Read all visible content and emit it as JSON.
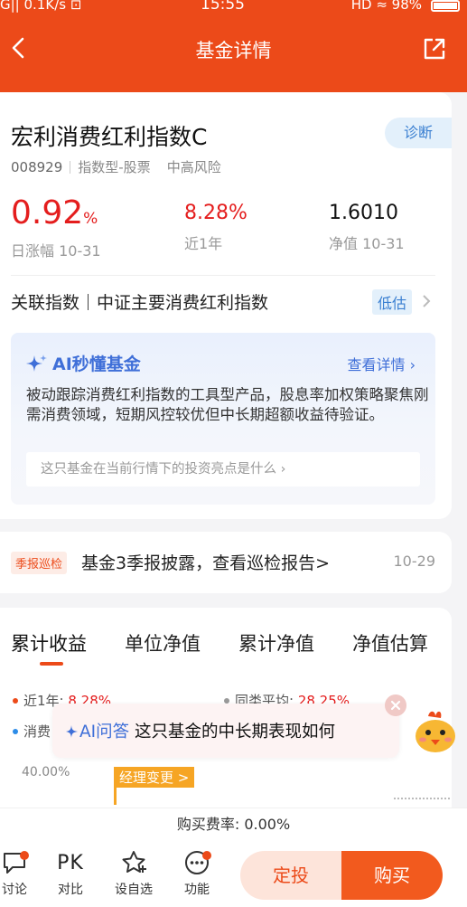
{
  "status": {
    "left": "G|| 0.1K/s ⊡",
    "time": "15:55",
    "right": "HD ≈ 98%"
  },
  "nav": {
    "title": "基金详情"
  },
  "fund": {
    "name": "宏利消费红利指数C",
    "diagnose_label": "诊断",
    "code": "008929",
    "type": "指数型-股票",
    "risk": "中高风险",
    "daily_change": "0.92",
    "daily_change_unit": "%",
    "daily_change_label": "日涨幅 10-31",
    "year_return": "8.28%",
    "year_return_label": "近1年",
    "nav_value": "1.6010",
    "nav_label": "净值 10-31"
  },
  "index_row": {
    "prefix": "关联指数",
    "index_name": "中证主要消费红利指数",
    "valuation_badge": "低估"
  },
  "ai_box": {
    "title": "AI秒懂基金",
    "more": "查看详情 ›",
    "text": "被动跟踪消费红利指数的工具型产品，股息率加权策略聚焦刚需消费领域，短期风控较优但中长期超额收益待验证。",
    "question": "这只基金在当前行情下的投资亮点是什么 ›"
  },
  "quarter": {
    "tag": "季报巡检",
    "text": "基金3季报披露，查看巡检报告>",
    "date": "10-29"
  },
  "tabs": [
    {
      "label": "累计收益"
    },
    {
      "label": "单位净值"
    },
    {
      "label": "累计净值"
    },
    {
      "label": "净值估算"
    }
  ],
  "legend": {
    "item1_label": "近1年: ",
    "item1_value": "8.28%",
    "item2_label": "同类平均: ",
    "item2_value": "28.25%",
    "item3_label": "消费"
  },
  "chart": {
    "y_label": "40.00%",
    "manager_tag": "经理变更 >"
  },
  "ai_popup": {
    "label": "AI问答",
    "question": "这只基金的中长期表现如何"
  },
  "fee": {
    "text": "购买费率: 0.00%"
  },
  "bottom_bar": {
    "discuss": "讨论",
    "compare_icon": "PK",
    "compare": "对比",
    "watchlist": "设自选",
    "functions": "功能",
    "dingtou": "定投",
    "buy": "购买"
  },
  "colors": {
    "brand": "#ec4a19",
    "up": "#e41d1d",
    "ai_blue": "#3f6fd8"
  }
}
